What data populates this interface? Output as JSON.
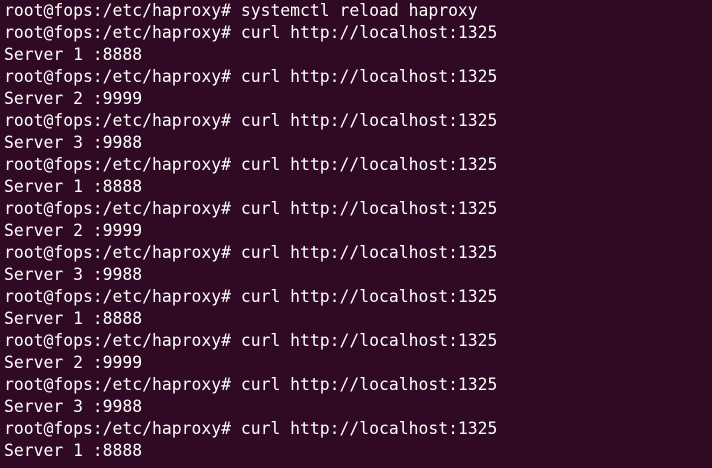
{
  "terminal": {
    "background": "#300a24",
    "foreground": "#ffffff",
    "prompt": "root@fops:/etc/haproxy#",
    "lines": [
      {
        "type": "cmd",
        "text": " systemctl reload haproxy"
      },
      {
        "type": "cmd",
        "text": " curl http://localhost:1325"
      },
      {
        "type": "out",
        "text": "Server 1 :8888"
      },
      {
        "type": "cmd",
        "text": " curl http://localhost:1325"
      },
      {
        "type": "out",
        "text": "Server 2 :9999"
      },
      {
        "type": "cmd",
        "text": " curl http://localhost:1325"
      },
      {
        "type": "out",
        "text": "Server 3 :9988"
      },
      {
        "type": "cmd",
        "text": " curl http://localhost:1325"
      },
      {
        "type": "out",
        "text": "Server 1 :8888"
      },
      {
        "type": "cmd",
        "text": " curl http://localhost:1325"
      },
      {
        "type": "out",
        "text": "Server 2 :9999"
      },
      {
        "type": "cmd",
        "text": " curl http://localhost:1325"
      },
      {
        "type": "out",
        "text": "Server 3 :9988"
      },
      {
        "type": "cmd",
        "text": " curl http://localhost:1325"
      },
      {
        "type": "out",
        "text": "Server 1 :8888"
      },
      {
        "type": "cmd",
        "text": " curl http://localhost:1325"
      },
      {
        "type": "out",
        "text": "Server 2 :9999"
      },
      {
        "type": "cmd",
        "text": " curl http://localhost:1325"
      },
      {
        "type": "out",
        "text": "Server 3 :9988"
      },
      {
        "type": "cmd",
        "text": " curl http://localhost:1325"
      },
      {
        "type": "out",
        "text": "Server 1 :8888"
      }
    ]
  }
}
